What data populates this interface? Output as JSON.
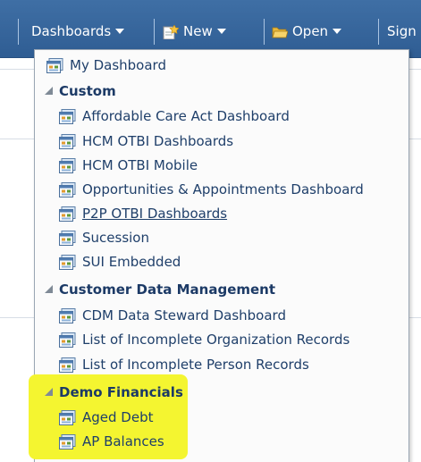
{
  "toolbar": {
    "dashboards_label": "Dashboards",
    "new_label": "New",
    "open_label": "Open",
    "sign_label": "Sign"
  },
  "menu": {
    "my_dashboard": "My Dashboard",
    "groups": [
      {
        "title": "Custom",
        "items": [
          "Affordable Care Act Dashboard",
          "HCM OTBI Dashboards",
          "HCM OTBI Mobile",
          "Opportunities & Appointments Dashboard",
          "P2P OTBI Dashboards",
          "Sucession",
          "SUI Embedded"
        ]
      },
      {
        "title": "Customer Data Management",
        "items": [
          "CDM Data Steward Dashboard",
          "List of Incomplete Organization Records",
          "List of Incomplete Person Records"
        ]
      },
      {
        "title": "Demo Financials",
        "items": [
          "Aged Debt",
          "AP Balances"
        ]
      }
    ]
  },
  "colors": {
    "toolbar_bg": "#3f6fa5",
    "menu_text": "#1f3f6a",
    "highlight": "#f4f530"
  }
}
